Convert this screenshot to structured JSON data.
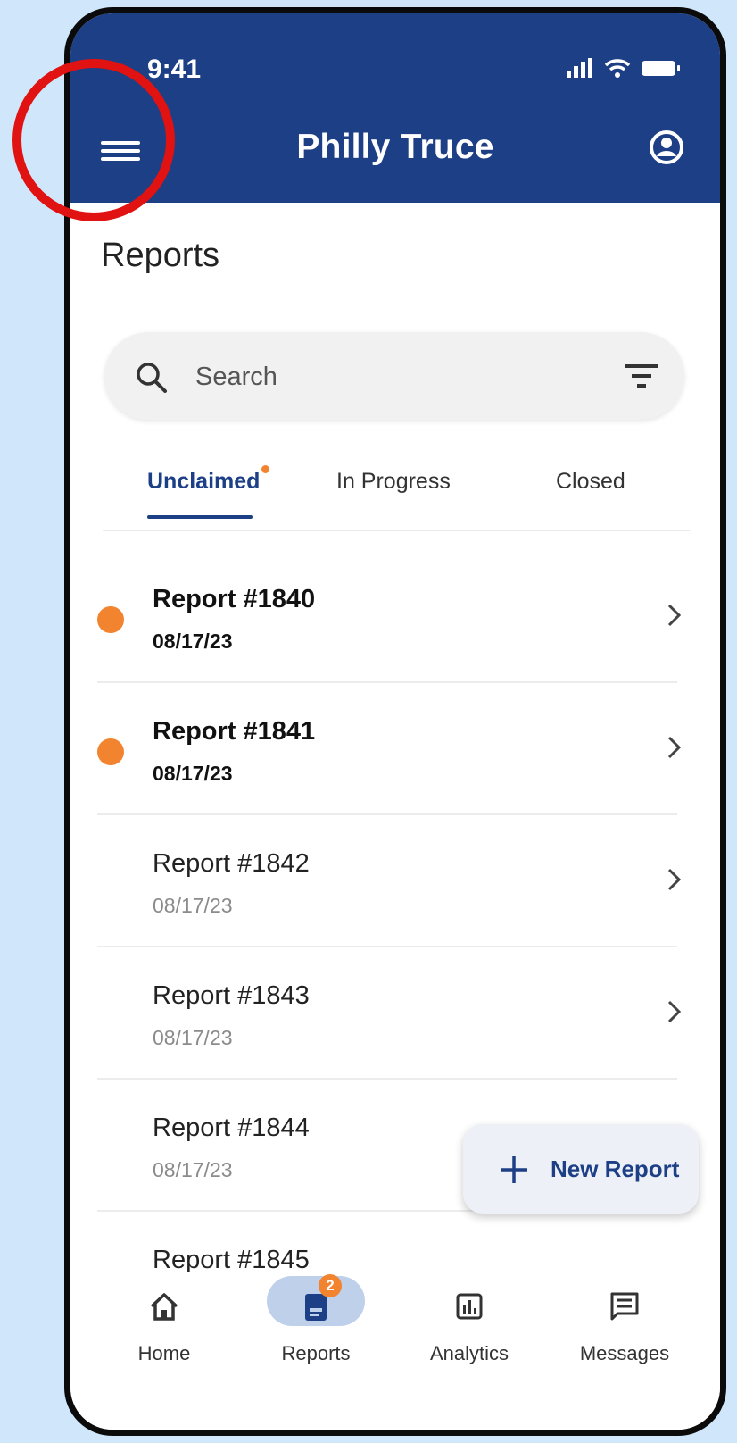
{
  "status_bar": {
    "time": "9:41"
  },
  "app_bar": {
    "title": "Philly Truce",
    "menu_icon": "menu-icon",
    "account_icon": "account-circle-icon"
  },
  "page": {
    "title": "Reports"
  },
  "search": {
    "placeholder": "Search",
    "value": ""
  },
  "tabs": [
    {
      "label": "Unclaimed",
      "active": true,
      "has_notification": true
    },
    {
      "label": "In Progress",
      "active": false
    },
    {
      "label": "Closed",
      "active": false
    }
  ],
  "reports": [
    {
      "title": "Report #1840",
      "date": "08/17/23",
      "unread": true
    },
    {
      "title": "Report #1841",
      "date": "08/17/23",
      "unread": true
    },
    {
      "title": "Report #1842",
      "date": "08/17/23",
      "unread": false
    },
    {
      "title": "Report #1843",
      "date": "08/17/23",
      "unread": false
    },
    {
      "title": "Report #1844",
      "date": "08/17/23",
      "unread": false
    },
    {
      "title": "Report #1845",
      "date": "",
      "unread": false
    }
  ],
  "fab": {
    "label": "New Report"
  },
  "bottom_nav": [
    {
      "label": "Home",
      "icon": "home-icon"
    },
    {
      "label": "Reports",
      "icon": "reports-icon",
      "badge": "2",
      "active": true
    },
    {
      "label": "Analytics",
      "icon": "analytics-icon"
    },
    {
      "label": "Messages",
      "icon": "messages-icon"
    }
  ],
  "colors": {
    "primary": "#1c3f86",
    "accent": "#f2832f",
    "background": "#cfe6fb",
    "highlight": "#e01212"
  }
}
